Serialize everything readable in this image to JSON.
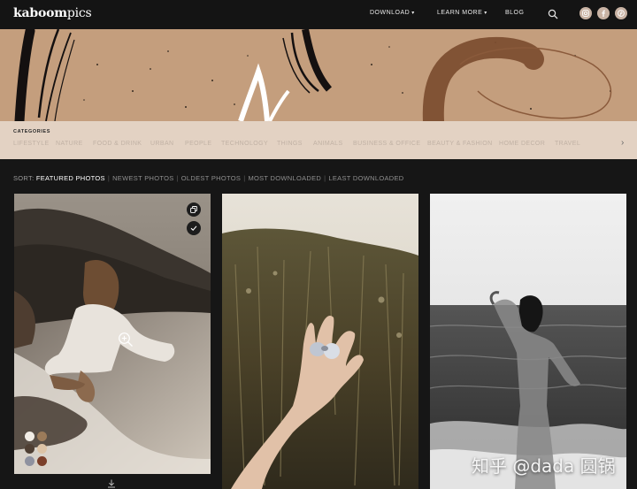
{
  "brand": {
    "logo_bold": "kaboom",
    "logo_light": "pics"
  },
  "nav": {
    "download": "DOWNLOAD",
    "learn_more": "LEARN MORE",
    "blog": "BLOG",
    "chevron": "⌄",
    "search_icon": "search-icon",
    "social_icons": [
      "instagram-icon",
      "facebook-icon",
      "pinterest-icon"
    ]
  },
  "categories": {
    "title": "CATEGORIES",
    "items": [
      "LIFESTYLE",
      "NATURE",
      "FOOD & DRINK",
      "URBAN",
      "PEOPLE",
      "TECHNOLOGY",
      "THINGS",
      "ANIMALS",
      "BUSINESS & OFFICE",
      "BEAUTY & FASHION",
      "HOME DECOR",
      "TRAVEL"
    ],
    "next_arrow": "›"
  },
  "sort": {
    "label": "SORT:",
    "options": [
      "FEATURED PHOTOS",
      "NEWEST PHOTOS",
      "OLDEST PHOTOS",
      "MOST DOWNLOADED",
      "LEAST DOWNLOADED"
    ],
    "active": "FEATURED PHOTOS",
    "separator": "|"
  },
  "photos": [
    {
      "name": "woman-crouching-on-beach",
      "icons": [
        "copy-icon",
        "check-icon",
        "zoom-in-icon",
        "download-icon"
      ],
      "palette": [
        "#f1ede6",
        "#9b7b5a",
        "#4f3f33",
        "#dcc3a6",
        "#8f92a0",
        "#7b3f2a"
      ]
    },
    {
      "name": "hand-with-ring-in-grass"
    },
    {
      "name": "woman-in-sea-black-white"
    }
  ],
  "watermark": "知乎 @dada 圆锅",
  "colors": {
    "background": "#161616",
    "hero": "#c49e7d",
    "categories_bg": "#e3d2c3"
  }
}
